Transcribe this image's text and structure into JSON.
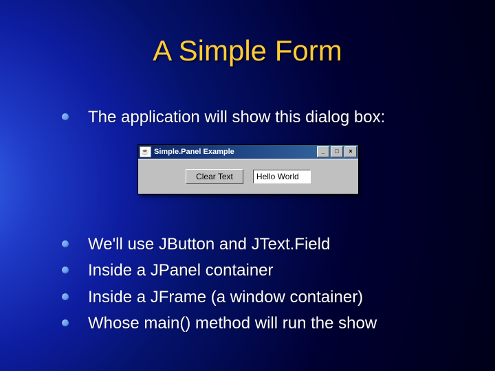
{
  "title": "A Simple Form",
  "bullet_top": "The application will show this dialog box:",
  "dialog": {
    "title": "Simple.Panel Example",
    "java_icon": "☕",
    "btn_min": "_",
    "btn_max": "□",
    "btn_close": "×",
    "clear_button": "Clear Text",
    "field_value": "Hello World"
  },
  "bullets_bottom": [
    "We'll use JButton and JText.Field",
    "Inside a JPanel container",
    "Inside a JFrame (a window container)",
    "Whose main() method will run the show"
  ]
}
